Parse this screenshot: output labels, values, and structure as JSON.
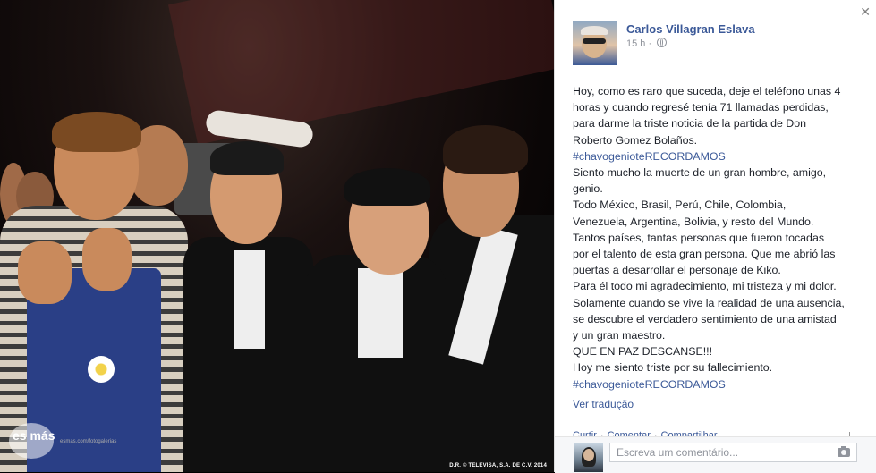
{
  "photo": {
    "watermark_logo": "es más",
    "watermark_url": "esmas.com/fotogalerias",
    "copyright": "D.R. © TELEVISA, S.A. DE C.V. 2014"
  },
  "post": {
    "author": "Carlos Villagran Eslava",
    "time": "15 h",
    "privacy_icon": "globe-icon",
    "lines": [
      {
        "text": "Hoy, como es raro que suceda, deje el teléfono unas 4",
        "type": "text"
      },
      {
        "text": "horas y cuando regresé tenía 71 llamadas perdidas,",
        "type": "text"
      },
      {
        "text": "para darme la triste noticia de la partida de Don",
        "type": "text"
      },
      {
        "text": "Roberto Gomez Bolaños.",
        "type": "text"
      },
      {
        "text": "#chavogenioteRECORDAMOS",
        "type": "tag"
      },
      {
        "text": "Siento mucho la muerte de un gran hombre, amigo,",
        "type": "text"
      },
      {
        "text": "genio.",
        "type": "text"
      },
      {
        "text": "Todo México, Brasil, Perú, Chile, Colombia,",
        "type": "text"
      },
      {
        "text": "Venezuela, Argentina, Bolivia, y resto del Mundo.",
        "type": "text"
      },
      {
        "text": "Tantos países, tantas personas que fueron tocadas",
        "type": "text"
      },
      {
        "text": "por el talento de esta gran persona. Que me abrió las",
        "type": "text"
      },
      {
        "text": "puertas a desarrollar el personaje de Kiko.",
        "type": "text"
      },
      {
        "text": "Para él todo mi agradecimiento, mi tristeza y mi dolor.",
        "type": "text"
      },
      {
        "text": "Solamente cuando se vive la realidad de una ausencia,",
        "type": "text"
      },
      {
        "text": "se descubre el verdadero sentimiento de una amistad",
        "type": "text"
      },
      {
        "text": "y un gran maestro.",
        "type": "text"
      },
      {
        "text": "QUE EN PAZ DESCANSE!!!",
        "type": "text"
      },
      {
        "text": "Hoy me siento triste por su fallecimiento.",
        "type": "text"
      },
      {
        "text": "#chavogenioteRECORDAMOS",
        "type": "tag"
      }
    ],
    "translate_link": "Ver tradução"
  },
  "actions": {
    "like": "Curtir",
    "comment": "Comentar",
    "share": "Compartilhar",
    "separator": "·"
  },
  "comment_box": {
    "placeholder": "Escreva um comentário..."
  },
  "close_label": "✕",
  "colors": {
    "link": "#3b5998",
    "text": "#1d2129",
    "meta": "#90949c"
  }
}
